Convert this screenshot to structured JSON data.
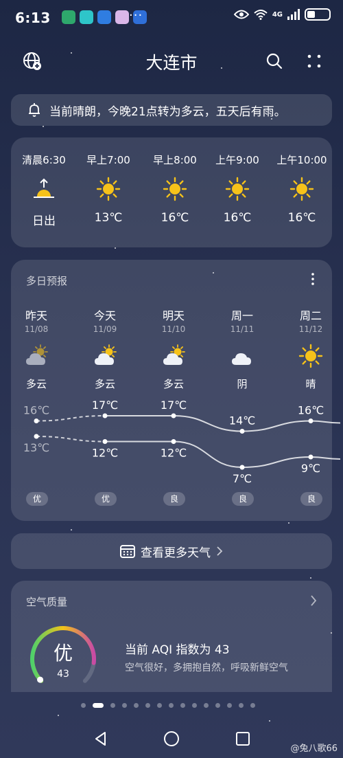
{
  "status_bar": {
    "time": "6:13",
    "app_icons": [
      {
        "name": "mobile-app-icon",
        "color": "#2ea86c"
      },
      {
        "name": "tile-app-icon",
        "color": "#2ec5c9"
      },
      {
        "name": "cloud-app-icon",
        "color": "#2f7de1"
      },
      {
        "name": "flower-app-icon",
        "color": "#d9b6e8"
      },
      {
        "name": "bulb-app-icon",
        "color": "#2f6fd8"
      }
    ],
    "more_dots": "···",
    "network_label": "4G",
    "battery_level": 0.35
  },
  "header": {
    "city": "大连市"
  },
  "alert": {
    "text": "当前晴朗，今晚21点转为多云，五天后有雨。"
  },
  "hourly": [
    {
      "time": "清晨6:30",
      "icon": "sunrise-icon",
      "value": "日出"
    },
    {
      "time": "早上7:00",
      "icon": "sun-icon",
      "value": "13℃"
    },
    {
      "time": "早上8:00",
      "icon": "sun-icon",
      "value": "16℃"
    },
    {
      "time": "上午9:00",
      "icon": "sun-icon",
      "value": "16℃"
    },
    {
      "time": "上午10:00",
      "icon": "sun-icon",
      "value": "16℃"
    }
  ],
  "forecast": {
    "title": "多日预报",
    "days": [
      {
        "name": "昨天",
        "date": "11/08",
        "icon": "partly-cloudy-icon",
        "condition": "多云",
        "aqi": "优"
      },
      {
        "name": "今天",
        "date": "11/09",
        "icon": "partly-cloudy-icon",
        "condition": "多云",
        "aqi": "优"
      },
      {
        "name": "明天",
        "date": "11/10",
        "icon": "partly-cloudy-icon",
        "condition": "多云",
        "aqi": "良"
      },
      {
        "name": "周一",
        "date": "11/11",
        "icon": "cloud-icon",
        "condition": "阴",
        "aqi": "良"
      },
      {
        "name": "周二",
        "date": "11/12",
        "icon": "sun-icon",
        "condition": "晴",
        "aqi": "良"
      }
    ],
    "high_labels": [
      "16℃",
      "17℃",
      "17℃",
      "14℃",
      "16℃"
    ],
    "low_labels": [
      "13℃",
      "12℃",
      "12℃",
      "7℃",
      "9℃"
    ]
  },
  "chart_data": {
    "type": "line",
    "categories": [
      "昨天",
      "今天",
      "明天",
      "周一",
      "周二"
    ],
    "series": [
      {
        "values": [
          16,
          17,
          17,
          14,
          16
        ]
      },
      {
        "values": [
          13,
          12,
          12,
          7,
          9
        ]
      }
    ],
    "ylim": [
      7,
      17
    ],
    "grid": false
  },
  "see_more": {
    "label": "查看更多天气"
  },
  "air_quality": {
    "title": "空气质量",
    "level": "优",
    "aqi": "43",
    "aqi_fraction": 0.86,
    "summary": "当前 AQI 指数为 43",
    "description": "空气很好，多拥抱自然，呼吸新鲜空气"
  },
  "pager": {
    "count": 15,
    "active": 1
  },
  "watermark": "@兔八歌66",
  "colors": {
    "sun": "#f6c21a",
    "gauge_start": "#4fd06a",
    "gauge_mid": "#f2c318",
    "gauge_end": "#c84aa5"
  }
}
